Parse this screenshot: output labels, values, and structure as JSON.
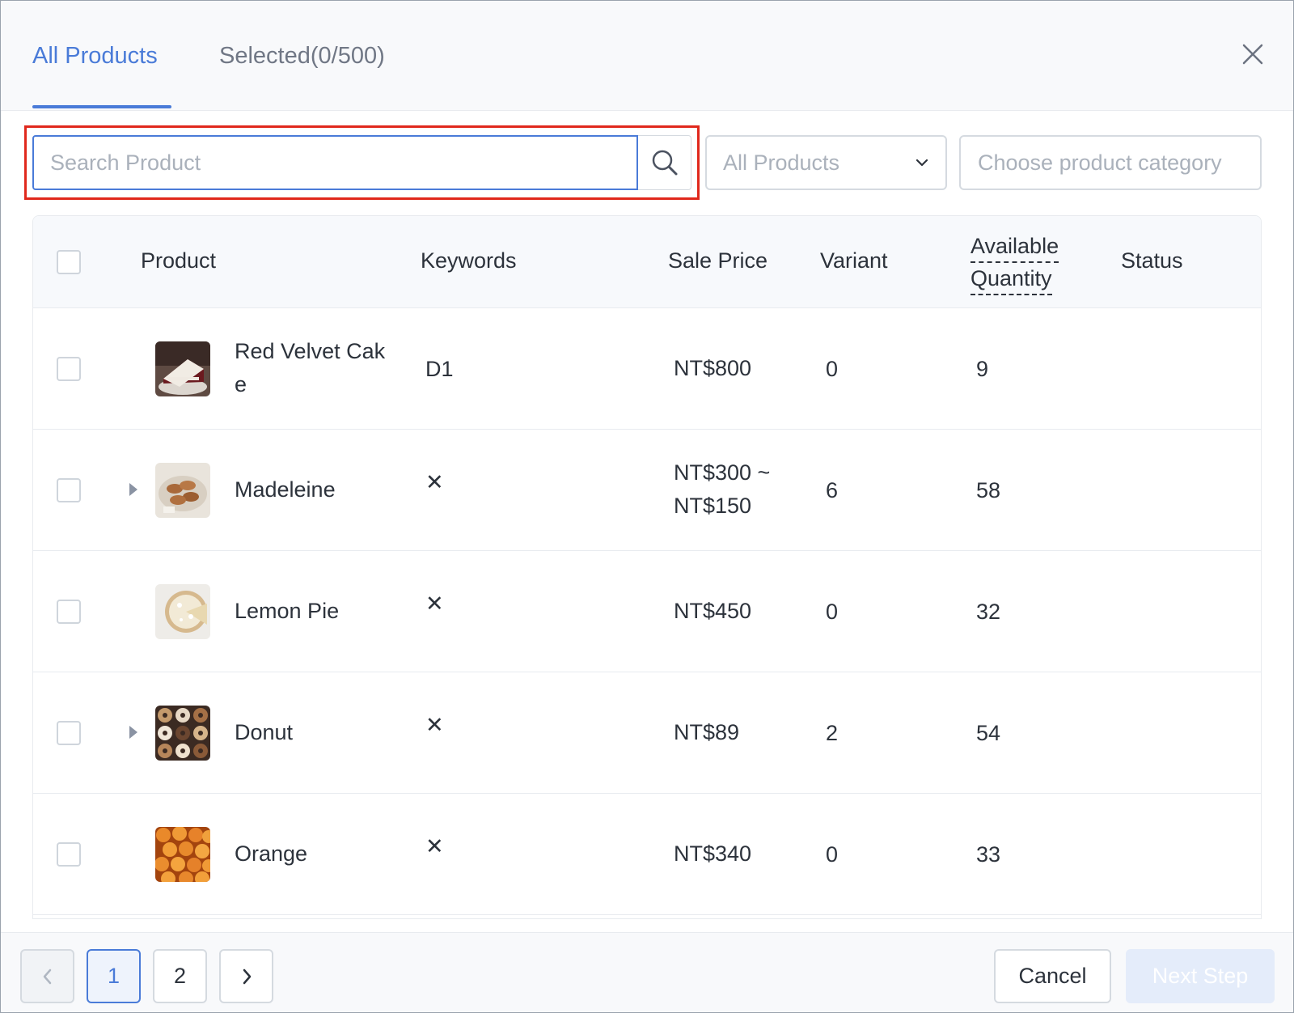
{
  "tabs": {
    "all_products": "All Products",
    "selected": "Selected(0/500)"
  },
  "search": {
    "placeholder": "Search Product",
    "value": ""
  },
  "filter_select": {
    "selected": "All Products"
  },
  "category_select": {
    "placeholder": "Choose product category"
  },
  "table": {
    "headers": {
      "product": "Product",
      "keywords": "Keywords",
      "sale_price": "Sale Price",
      "variant": "Variant",
      "available_1": "Available",
      "available_2": "Quantity",
      "status": "Status"
    },
    "rows": [
      {
        "name_1": "Red Velvet Cak",
        "name_2": "e",
        "keyword": "D1",
        "price_1": "NT$800",
        "price_2": "",
        "variant": "0",
        "quantity": "9",
        "status": "",
        "expandable": false,
        "image": "red-velvet-cake"
      },
      {
        "name_1": "Madeleine",
        "name_2": "",
        "keyword": "✕",
        "price_1": "NT$300 ~",
        "price_2": "NT$150",
        "variant": "6",
        "quantity": "58",
        "status": "",
        "expandable": true,
        "image": "madeleine"
      },
      {
        "name_1": "Lemon Pie",
        "name_2": "",
        "keyword": "✕",
        "price_1": "NT$450",
        "price_2": "",
        "variant": "0",
        "quantity": "32",
        "status": "",
        "expandable": false,
        "image": "lemon-pie"
      },
      {
        "name_1": "Donut",
        "name_2": "",
        "keyword": "✕",
        "price_1": "NT$89",
        "price_2": "",
        "variant": "2",
        "quantity": "54",
        "status": "",
        "expandable": true,
        "image": "donut"
      },
      {
        "name_1": "Orange",
        "name_2": "",
        "keyword": "✕",
        "price_1": "NT$340",
        "price_2": "",
        "variant": "0",
        "quantity": "33",
        "status": "",
        "expandable": false,
        "image": "orange"
      }
    ]
  },
  "pagination": {
    "pages": [
      "1",
      "2"
    ],
    "current": "1"
  },
  "footer": {
    "cancel": "Cancel",
    "next_step": "Next Step"
  },
  "colors": {
    "accent": "#4a7bd8",
    "highlight": "#e0281c",
    "disabled_primary": "#e4ecfa"
  },
  "icons": {
    "close": "close-icon",
    "search": "search-icon",
    "dropdown": "chevron-down-icon",
    "expand": "caret-right-icon",
    "prev": "chevron-left-icon",
    "next": "chevron-right-icon"
  }
}
